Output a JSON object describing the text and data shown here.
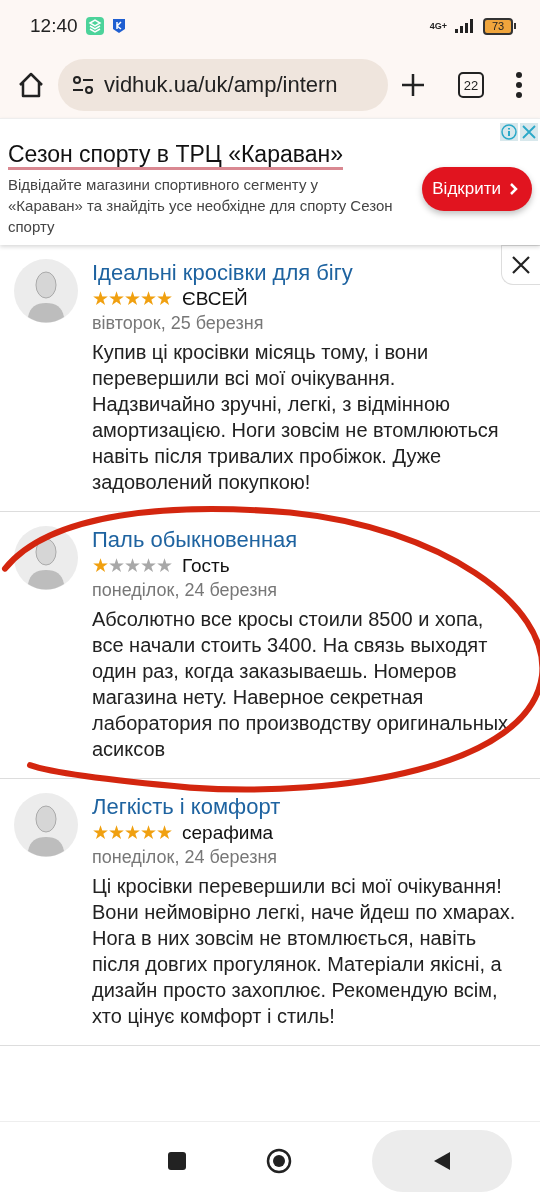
{
  "status_bar": {
    "time": "12:40",
    "network": "4G+",
    "battery": "73"
  },
  "browser": {
    "url": "vidhuk.ua/uk/amp/intern",
    "tab_count": "22"
  },
  "ad": {
    "title": "Сезон спорту в ТРЦ «Караван»",
    "text": "Відвідайте магазини спортивного сегменту у «Караван» та знайдіть усе необхідне для спорту Сезон спорту",
    "button": "Відкрити"
  },
  "reviews": [
    {
      "title": "Ідеальні кросівки для бігу",
      "stars": 5,
      "author": "ЄВСЕЙ",
      "date": "вівторок, 25 березня",
      "text": "Купив ці кросівки місяць тому, і вони перевершили всі мої очікування. Надзвичайно зручні, легкі, з відмінною амортизацією. Ноги зовсім не втомлюються навіть після тривалих пробіжок. Дуже задоволений покупкою!",
      "highlighted": false
    },
    {
      "title": "Паль обыкновенная",
      "stars": 1,
      "author": "Гость",
      "date": "понеділок, 24 березня",
      "text": "Абсолютно все кросы стоили 8500 и хопа, все начали стоить 3400. На связь выходят один раз, когда заказываешь. Номеров магазина нету. Наверное секретная лаборатория по производству оригинальных асиксов",
      "highlighted": true
    },
    {
      "title": "Легкість і комфорт",
      "stars": 5,
      "author": "серафима",
      "date": "понеділок, 24 березня",
      "text": "Ці кросівки перевершили всі мої очікування! Вони неймовірно легкі, наче йдеш по хмарах. Нога в них зовсім не втомлюється, навіть після довгих прогулянок. Матеріали якісні, а дизайн просто захоплює. Рекомендую всім, хто цінує комфорт і стиль!",
      "highlighted": false
    }
  ]
}
